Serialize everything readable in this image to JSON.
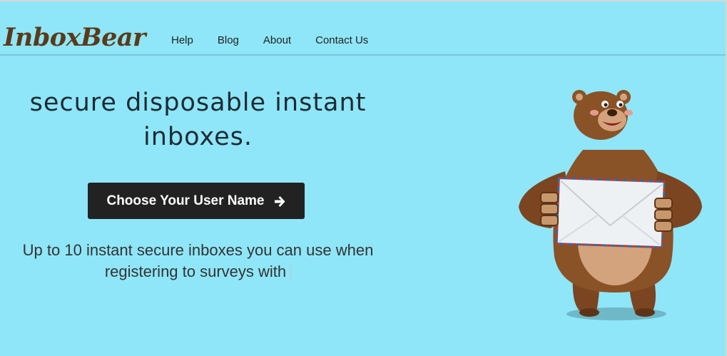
{
  "header": {
    "logo": "InboxBear",
    "nav": [
      {
        "label": "Help"
      },
      {
        "label": "Blog"
      },
      {
        "label": "About"
      },
      {
        "label": "Contact Us"
      }
    ]
  },
  "hero": {
    "title_line1": "secure disposable instant",
    "title_line2": "inboxes.",
    "cta_label": "Choose Your User Name",
    "cta_icon": "arrow-right-icon",
    "subtitle_line1": "Up to 10 instant secure inboxes you can use when",
    "subtitle_line2": "registering to surveys with"
  },
  "colors": {
    "background": "#8fe6f8",
    "logo": "#5a3a1a",
    "button": "#222222",
    "bear_fur": "#8a5227"
  }
}
